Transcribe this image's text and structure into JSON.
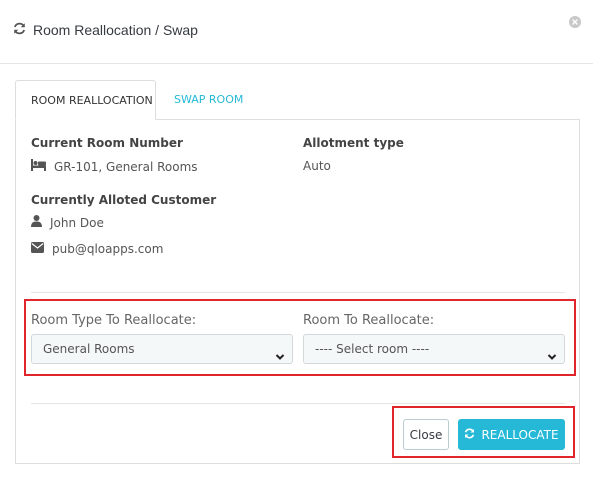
{
  "modal": {
    "title": "Room Reallocation / Swap"
  },
  "tabs": [
    {
      "label": "ROOM REALLOCATION",
      "active": true
    },
    {
      "label": "SWAP ROOM",
      "active": false
    }
  ],
  "details": {
    "current_room_label": "Current Room Number",
    "current_room_value": "GR-101, General Rooms",
    "allotment_label": "Allotment type",
    "allotment_value": "Auto",
    "customer_label": "Currently Alloted Customer",
    "customer_name": "John Doe",
    "customer_email": "pub@qloapps.com"
  },
  "form": {
    "room_type_label": "Room Type To Reallocate:",
    "room_type_selected": "General Rooms",
    "room_label": "Room To Reallocate:",
    "room_selected": "---- Select room ----"
  },
  "actions": {
    "close_label": "Close",
    "reallocate_label": "REALLOCATE"
  },
  "colors": {
    "accent": "#25b9d7",
    "highlight": "#e0262b",
    "border": "#dddddd"
  },
  "icons": {
    "title": "refresh-icon",
    "room": "bed-icon",
    "customer": "user-icon",
    "email": "envelope-icon",
    "close": "close-icon",
    "reallocate": "refresh-icon"
  }
}
